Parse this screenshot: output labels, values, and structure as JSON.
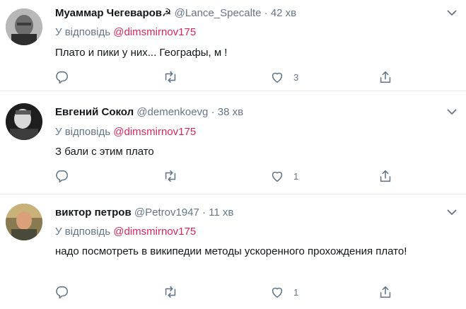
{
  "tweets": [
    {
      "name": "Муаммар Чегеваров",
      "name_symbol": "☭",
      "handle": "@Lance_Specalte",
      "dot": "·",
      "time": "42 хв",
      "reply_prefix": "У відповідь",
      "reply_mention": "@dimsmirnov175",
      "text": "Плато и пики у них... Географы, м    !",
      "like_count": "3"
    },
    {
      "name": "Евгений Сокол",
      "name_symbol": "",
      "handle": "@demenkoevg",
      "dot": "·",
      "time": "38 хв",
      "reply_prefix": "У відповідь",
      "reply_mention": "@dimsmirnov175",
      "text": "З    бали с этим плато",
      "like_count": "1"
    },
    {
      "name": "виктор петров",
      "name_symbol": "",
      "handle": "@Petrov1947",
      "dot": "·",
      "time": "11 хв",
      "reply_prefix": "У відповідь",
      "reply_mention": "@dimsmirnov175",
      "text": "надо посмотреть в википедии методы ускоренного прохождения плато!",
      "like_count": "1"
    }
  ],
  "icons": {
    "reply": "reply-icon",
    "retweet": "retweet-icon",
    "like": "like-icon",
    "share": "share-icon",
    "caret": "chevron-down-icon"
  },
  "colors": {
    "mention": "#e0245e",
    "secondary_text": "#657786",
    "separator": "#e6ecf0"
  }
}
